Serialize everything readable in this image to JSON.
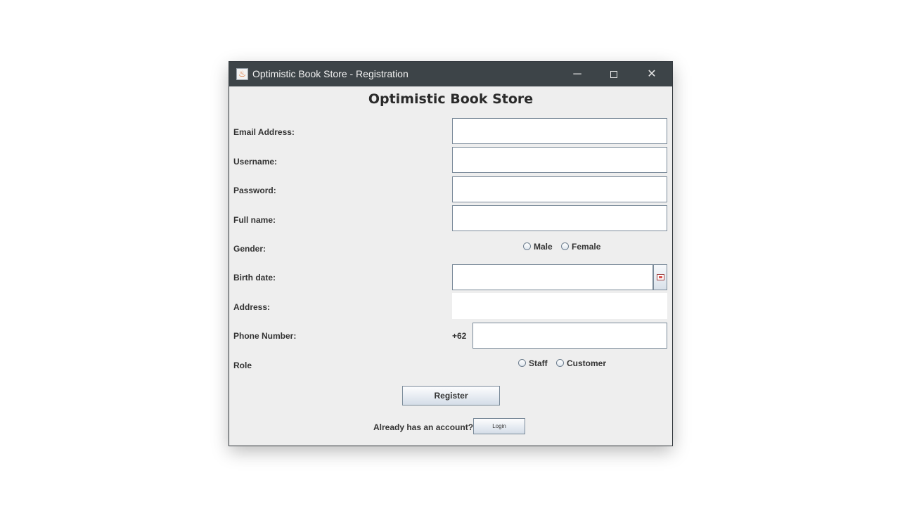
{
  "window": {
    "title": "Optimistic Book Store - Registration",
    "controls": {
      "minimize": "─",
      "close": "✕"
    }
  },
  "form": {
    "heading": "Optimistic Book Store",
    "labels": {
      "email": "Email Address:",
      "username": "Username:",
      "password": "Password:",
      "fullname": "Full name:",
      "gender": "Gender:",
      "birthdate": "Birth date:",
      "address": "Address:",
      "phone": "Phone Number:",
      "role": "Role"
    },
    "values": {
      "email": "",
      "username": "",
      "password": "",
      "fullname": "",
      "birthdate": "",
      "address": "",
      "phone": ""
    },
    "gender_options": [
      "Male",
      "Female"
    ],
    "phone_prefix": "+62",
    "role_options": [
      "Staff",
      "Customer"
    ],
    "register_label": "Register",
    "account_question": "Already has an account?",
    "login_label": "Login"
  }
}
